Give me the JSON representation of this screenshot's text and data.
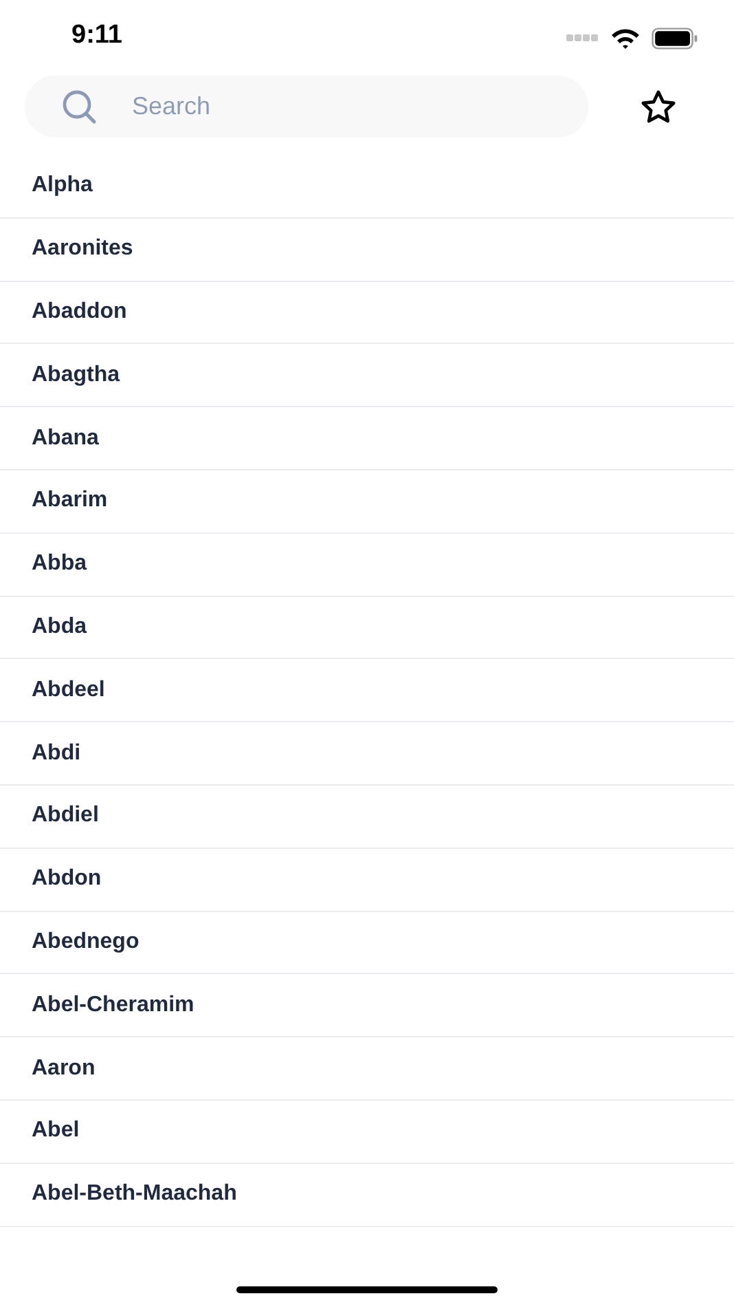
{
  "status_bar": {
    "time": "9:11"
  },
  "search": {
    "placeholder": "Search"
  },
  "items": [
    "Alpha",
    "Aaronites",
    "Abaddon",
    "Abagtha",
    "Abana",
    "Abarim",
    "Abba",
    "Abda",
    "Abdeel",
    "Abdi",
    "Abdiel",
    "Abdon",
    "Abednego",
    "Abel-Cheramim",
    "Aaron",
    "Abel",
    "Abel-Beth-Maachah"
  ]
}
